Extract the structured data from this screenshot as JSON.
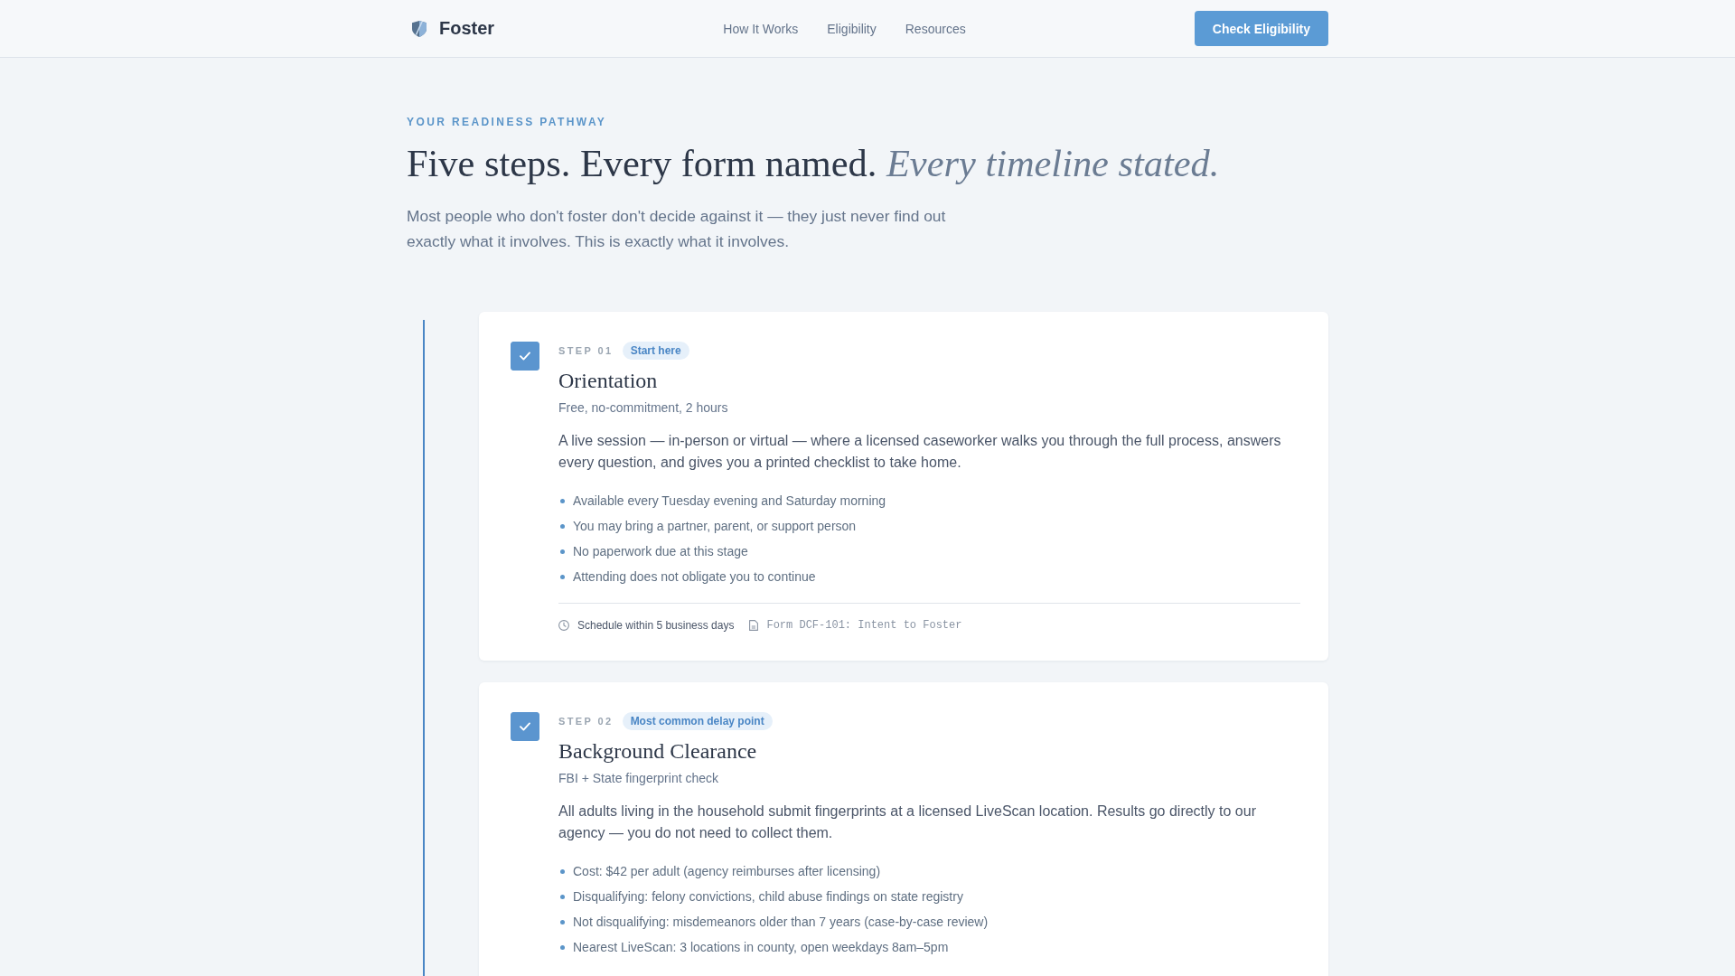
{
  "header": {
    "brand": "Foster",
    "nav": [
      "How It Works",
      "Eligibility",
      "Resources"
    ],
    "cta": "Check Eligibility"
  },
  "hero": {
    "eyebrow": "YOUR READINESS PATHWAY",
    "title": "Five steps. Every form named. *Every timeline stated.*",
    "intro": "Most people who don't foster don't decide against it — they just never find out exactly what it involves. This is exactly what it involves."
  },
  "steps": [
    {
      "label": "STEP 01",
      "badge": "Start here",
      "checked": true,
      "title": "Orientation",
      "subtitle": "Free, no-commitment, 2 hours",
      "description": "A live session — in-person or virtual — where a licensed caseworker walks you through the full process, answers every question, and gives you a printed checklist to take home.",
      "bullets": [
        "Available every Tuesday evening and Saturday morning",
        "You may bring a partner, parent, or support person",
        "No paperwork due at this stage",
        "Attending does not obligate you to continue"
      ],
      "footer": [
        {
          "kind": "schedule",
          "text": "Schedule within 5 business days"
        },
        {
          "kind": "form",
          "text": "Form DCF-101: Intent to Foster"
        }
      ]
    },
    {
      "label": "STEP 02",
      "badge": "Most common delay point",
      "checked": true,
      "title": "Background Clearance",
      "subtitle": "FBI + State fingerprint check",
      "description": "All adults living in the household submit fingerprints at a licensed LiveScan location. Results go directly to our agency — you do not need to collect them.",
      "bullets": [
        "Cost: $42 per adult (agency reimburses after licensing)",
        "Disqualifying: felony convictions, child abuse findings on state registry",
        "Not disqualifying: misdemeanors older than 7 years (case-by-case review)",
        "Nearest LiveScan: 3 locations in county, open weekdays 8am–5pm"
      ]
    }
  ]
}
